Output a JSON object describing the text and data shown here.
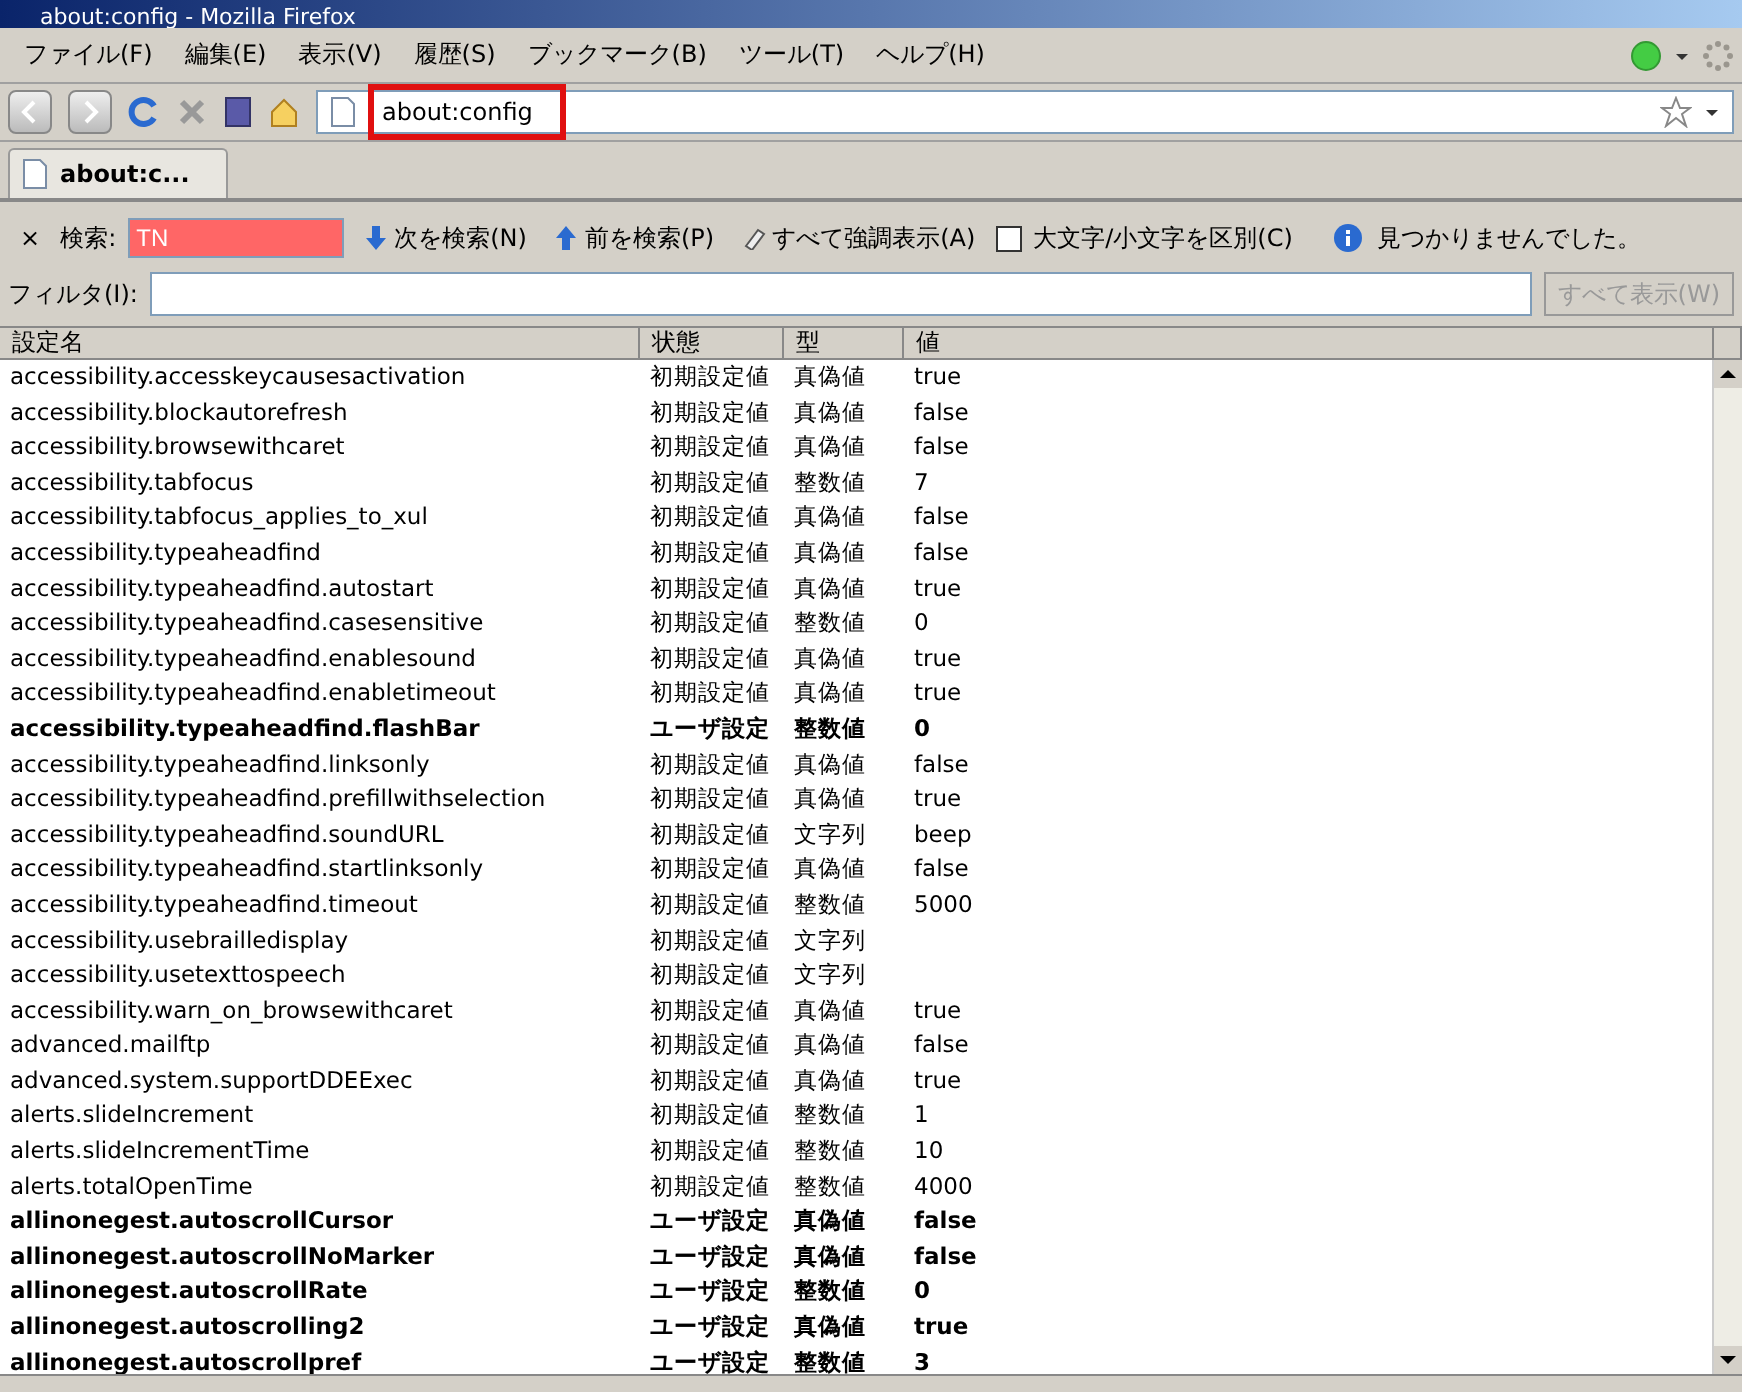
{
  "window": {
    "title": "about:config - Mozilla Firefox"
  },
  "menu": [
    "ファイル(F)",
    "編集(E)",
    "表示(V)",
    "履歴(S)",
    "ブックマーク(B)",
    "ツール(T)",
    "ヘルプ(H)"
  ],
  "address": {
    "value": "about:config",
    "highlighted": true
  },
  "tabs": [
    {
      "label": "about:c...",
      "selected": true
    }
  ],
  "findbar": {
    "close": "×",
    "label": "検索:",
    "value": "TN",
    "not_found": true,
    "next": "次を検索(N)",
    "previous": "前を検索(P)",
    "highlight_all": "すべて強調表示(A)",
    "match_case": {
      "label": "大文字/小文字を区別(C)",
      "checked": false
    },
    "status": "見つかりませんでした。"
  },
  "filter": {
    "label": "フィルタ(I):",
    "button": "すべて表示(W)"
  },
  "table": {
    "columns": [
      "設定名",
      "状態",
      "型",
      "値"
    ],
    "rows": [
      {
        "name": "accessibility.accesskeycausesactivation",
        "status": "初期設定値",
        "type": "真偽値",
        "value": "true",
        "modified": false
      },
      {
        "name": "accessibility.blockautorefresh",
        "status": "初期設定値",
        "type": "真偽値",
        "value": "false",
        "modified": false
      },
      {
        "name": "accessibility.browsewithcaret",
        "status": "初期設定値",
        "type": "真偽値",
        "value": "false",
        "modified": false
      },
      {
        "name": "accessibility.tabfocus",
        "status": "初期設定値",
        "type": "整数値",
        "value": "7",
        "modified": false
      },
      {
        "name": "accessibility.tabfocus_applies_to_xul",
        "status": "初期設定値",
        "type": "真偽値",
        "value": "false",
        "modified": false
      },
      {
        "name": "accessibility.typeaheadfind",
        "status": "初期設定値",
        "type": "真偽値",
        "value": "false",
        "modified": false
      },
      {
        "name": "accessibility.typeaheadfind.autostart",
        "status": "初期設定値",
        "type": "真偽値",
        "value": "true",
        "modified": false
      },
      {
        "name": "accessibility.typeaheadfind.casesensitive",
        "status": "初期設定値",
        "type": "整数値",
        "value": "0",
        "modified": false
      },
      {
        "name": "accessibility.typeaheadfind.enablesound",
        "status": "初期設定値",
        "type": "真偽値",
        "value": "true",
        "modified": false
      },
      {
        "name": "accessibility.typeaheadfind.enabletimeout",
        "status": "初期設定値",
        "type": "真偽値",
        "value": "true",
        "modified": false
      },
      {
        "name": "accessibility.typeaheadfind.flashBar",
        "status": "ユーザ設定",
        "type": "整数値",
        "value": "0",
        "modified": true
      },
      {
        "name": "accessibility.typeaheadfind.linksonly",
        "status": "初期設定値",
        "type": "真偽値",
        "value": "false",
        "modified": false
      },
      {
        "name": "accessibility.typeaheadfind.prefillwithselection",
        "status": "初期設定値",
        "type": "真偽値",
        "value": "true",
        "modified": false
      },
      {
        "name": "accessibility.typeaheadfind.soundURL",
        "status": "初期設定値",
        "type": "文字列",
        "value": "beep",
        "modified": false
      },
      {
        "name": "accessibility.typeaheadfind.startlinksonly",
        "status": "初期設定値",
        "type": "真偽値",
        "value": "false",
        "modified": false
      },
      {
        "name": "accessibility.typeaheadfind.timeout",
        "status": "初期設定値",
        "type": "整数値",
        "value": "5000",
        "modified": false
      },
      {
        "name": "accessibility.usebrailledisplay",
        "status": "初期設定値",
        "type": "文字列",
        "modified": false
      },
      {
        "name": "accessibility.usetexttospeech",
        "status": "初期設定値",
        "type": "文字列",
        "modified": false
      },
      {
        "name": "accessibility.warn_on_browsewithcaret",
        "status": "初期設定値",
        "type": "真偽値",
        "value": "true",
        "modified": false
      },
      {
        "name": "advanced.mailftp",
        "status": "初期設定値",
        "type": "真偽値",
        "value": "false",
        "modified": false
      },
      {
        "name": "advanced.system.supportDDEExec",
        "status": "初期設定値",
        "type": "真偽値",
        "value": "true",
        "modified": false
      },
      {
        "name": "alerts.slideIncrement",
        "status": "初期設定値",
        "type": "整数値",
        "value": "1",
        "modified": false
      },
      {
        "name": "alerts.slideIncrementTime",
        "status": "初期設定値",
        "type": "整数値",
        "value": "10",
        "modified": false
      },
      {
        "name": "alerts.totalOpenTime",
        "status": "初期設定値",
        "type": "整数値",
        "value": "4000",
        "modified": false
      },
      {
        "name": "allinonegest.autoscrollCursor",
        "status": "ユーザ設定",
        "type": "真偽値",
        "value": "false",
        "modified": true
      },
      {
        "name": "allinonegest.autoscrollNoMarker",
        "status": "ユーザ設定",
        "type": "真偽値",
        "value": "false",
        "modified": true
      },
      {
        "name": "allinonegest.autoscrollRate",
        "status": "ユーザ設定",
        "type": "整数値",
        "value": "0",
        "modified": true
      },
      {
        "name": "allinonegest.autoscrolling2",
        "status": "ユーザ設定",
        "type": "真偽値",
        "value": "true",
        "modified": true
      },
      {
        "name": "allinonegest.autoscrollpref",
        "status": "ユーザ設定",
        "type": "整数値",
        "value": "3",
        "modified": true
      }
    ]
  }
}
